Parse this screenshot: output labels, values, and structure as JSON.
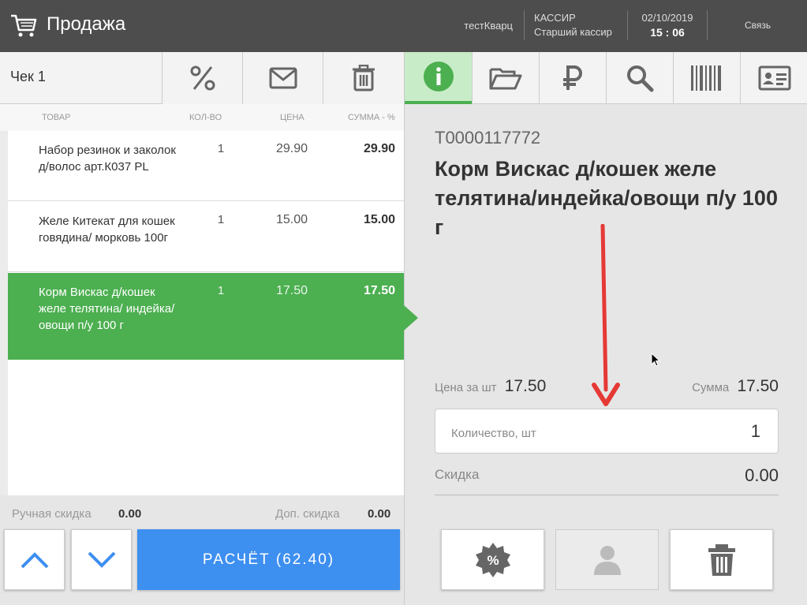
{
  "header": {
    "title": "Продажа",
    "store": "тестКварц",
    "cashier_label": "КАССИР",
    "cashier_role": "Старший кассир",
    "date": "02/10/2019",
    "time": "15 : 06",
    "link": "Связь"
  },
  "left": {
    "check_label": "Чек 1",
    "columns": {
      "product": "ТОВАР",
      "qty": "КОЛ-ВО",
      "price": "ЦЕНА",
      "sum": "СУММА - %"
    },
    "items": [
      {
        "name": "Набор резинок и заколок д/волос арт.К037 PL",
        "qty": "1",
        "price": "29.90",
        "sum": "29.90"
      },
      {
        "name": "Желе Китекат для кошек говядина/ морковь 100г",
        "qty": "1",
        "price": "15.00",
        "sum": "15.00"
      },
      {
        "name": "Корм Вискас д/кошек желе телятина/ индейка/овощи п/у 100 г",
        "qty": "1",
        "price": "17.50",
        "sum": "17.50"
      }
    ],
    "manual_discount_label": "Ручная скидка",
    "manual_discount_value": "0.00",
    "extra_discount_label": "Доп. скидка",
    "extra_discount_value": "0.00",
    "pay_label": "РАСЧЁТ (62.40)"
  },
  "right": {
    "sku": "Т0000117772",
    "product_name": "Корм Вискас д/кошек желе телятина/индейка/овощи п/у 100 г",
    "unit_price_label": "Цена за шт",
    "unit_price": "17.50",
    "sum_label": "Сумма",
    "sum": "17.50",
    "qty_label": "Количество, шт",
    "qty_value": "1",
    "discount_label": "Скидка",
    "discount_value": "0.00"
  },
  "colors": {
    "header_bg": "#4d4d4d",
    "accent_green": "#4caf50",
    "pay_blue": "#3d8ff0",
    "arrow_red": "#e53935"
  }
}
